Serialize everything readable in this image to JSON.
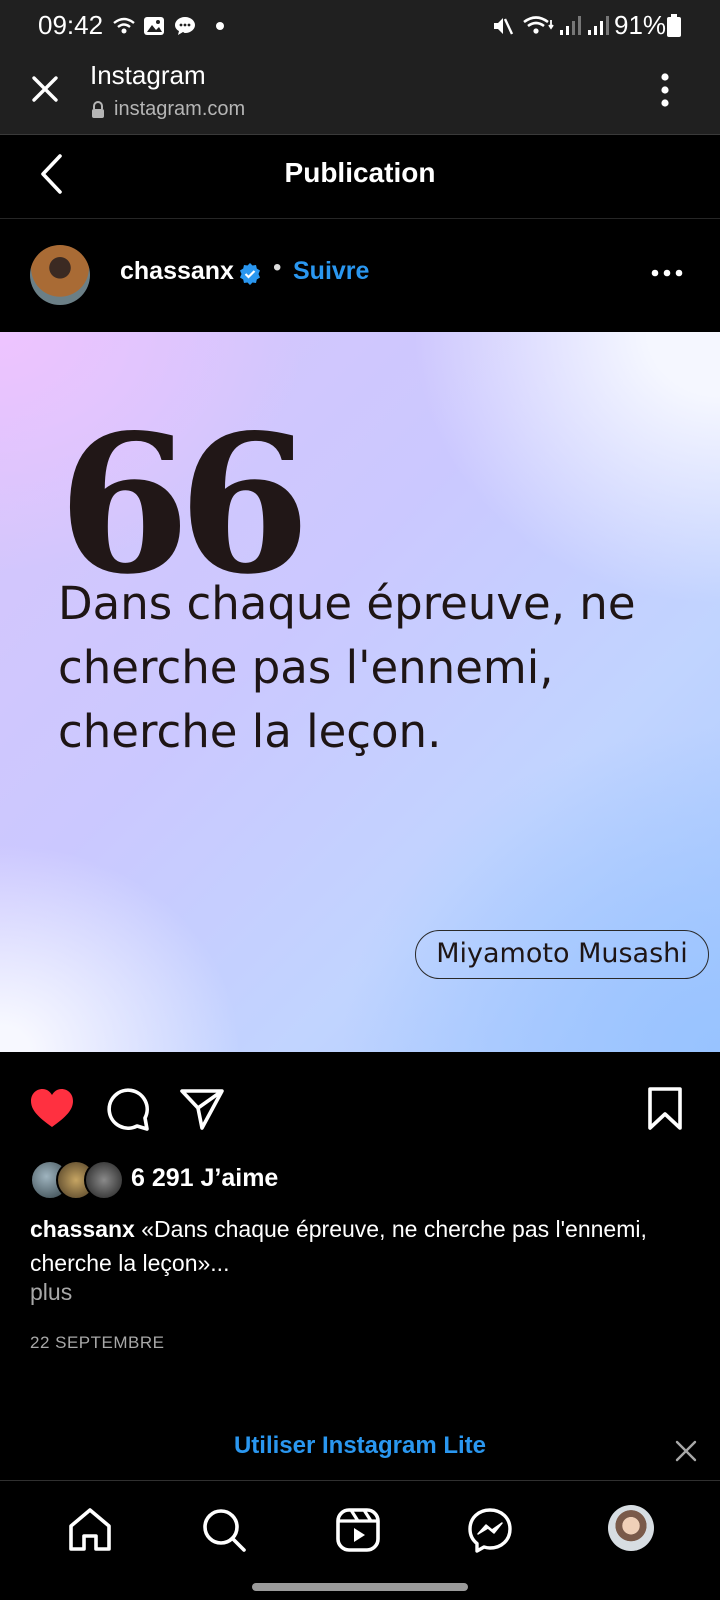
{
  "status_bar": {
    "time": "09:42",
    "battery": "91%"
  },
  "browser": {
    "title": "Instagram",
    "url": "instagram.com"
  },
  "header": {
    "title": "Publication"
  },
  "author": {
    "username": "chassanx",
    "separator": "•",
    "follow_label": "Suivre"
  },
  "post": {
    "quote_mark": "66",
    "quote": "Dans chaque épreuve, ne cherche pas l'ennemi, cherche la leçon.",
    "quote_author": "Miyamoto Musashi"
  },
  "engagement": {
    "likes": "6 291 J’aime",
    "liked": true,
    "caption_user": "chassanx",
    "caption_text": "«Dans chaque épreuve, ne cherche pas l'ennemi, cherche la leçon»...",
    "more_label": "plus",
    "date": "22 SEPTEMBRE"
  },
  "banner": {
    "label": "Utiliser Instagram Lite"
  },
  "colors": {
    "accent": "#2a97f0",
    "like": "#ff3040",
    "background": "#000000"
  },
  "icons": {
    "actions": [
      "heart-icon",
      "comment-icon",
      "share-icon",
      "bookmark-icon"
    ],
    "nav": [
      "home-icon",
      "search-icon",
      "reels-icon",
      "messenger-icon",
      "profile-avatar"
    ]
  }
}
